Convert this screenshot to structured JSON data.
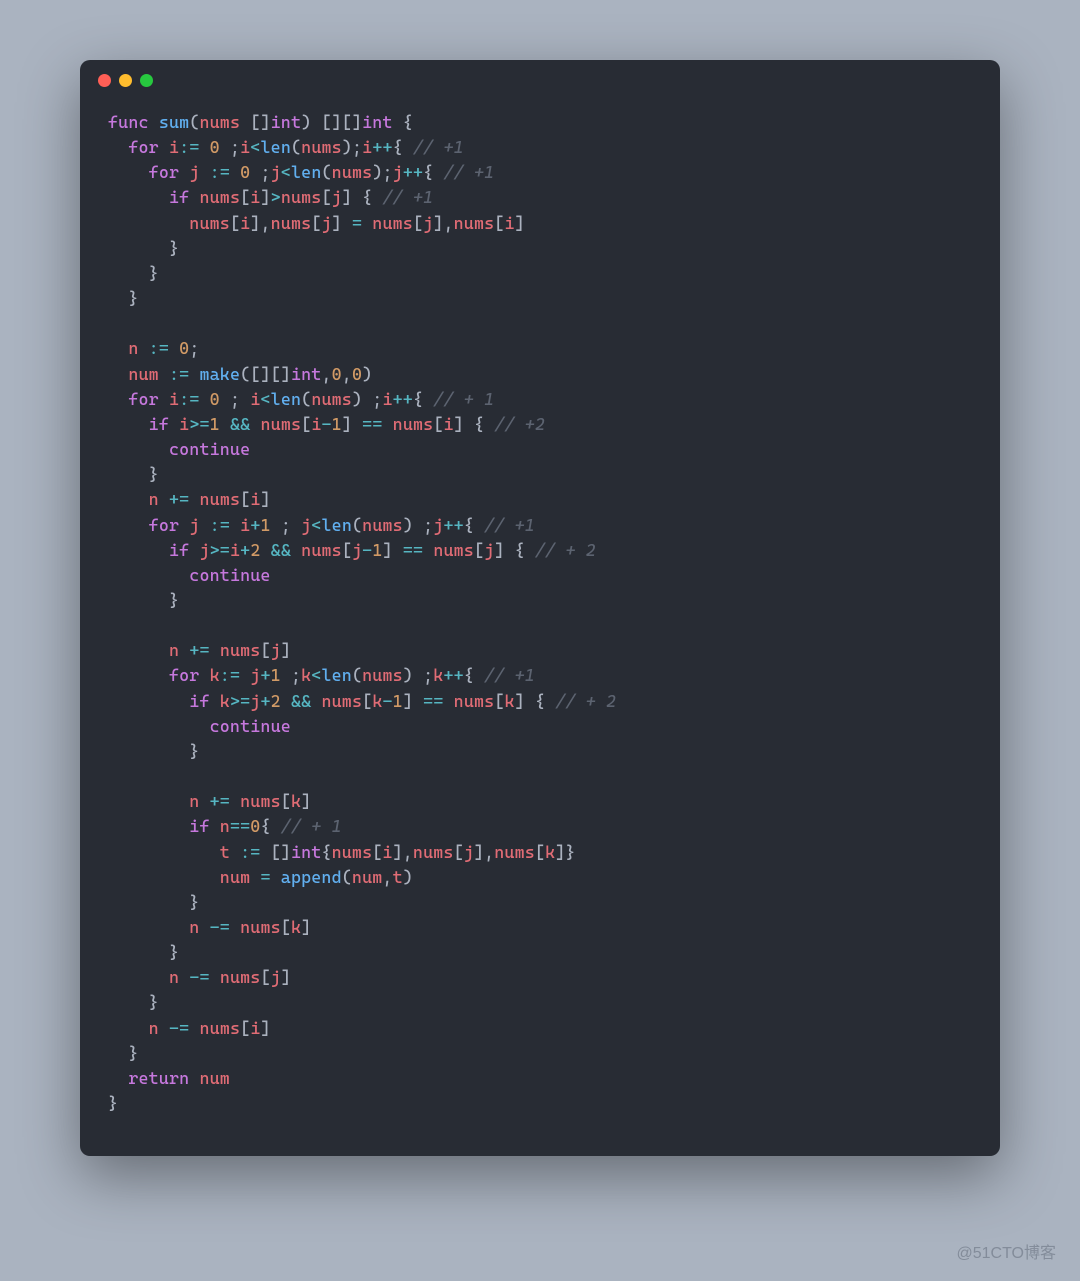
{
  "watermark": "@51CTO博客",
  "code_lines": [
    [
      [
        "kw",
        "func"
      ],
      [
        "pn",
        " "
      ],
      [
        "fn",
        "sum"
      ],
      [
        "pn",
        "("
      ],
      [
        "var",
        "nums"
      ],
      [
        "pn",
        " []"
      ],
      [
        "ty",
        "int"
      ],
      [
        "pn",
        ") [][]"
      ],
      [
        "ty",
        "int"
      ],
      [
        "pn",
        " {"
      ]
    ],
    [
      [
        "pn",
        "  "
      ],
      [
        "kw",
        "for"
      ],
      [
        "pn",
        " "
      ],
      [
        "var",
        "i"
      ],
      [
        "op",
        ":="
      ],
      [
        "pn",
        " "
      ],
      [
        "num",
        "0"
      ],
      [
        "pn",
        " ;"
      ],
      [
        "var",
        "i"
      ],
      [
        "op",
        "<"
      ],
      [
        "fn",
        "len"
      ],
      [
        "pn",
        "("
      ],
      [
        "var",
        "nums"
      ],
      [
        "pn",
        ");"
      ],
      [
        "var",
        "i"
      ],
      [
        "op",
        "++"
      ],
      [
        "pn",
        "{ "
      ],
      [
        "cm",
        "// +1"
      ]
    ],
    [
      [
        "pn",
        "    "
      ],
      [
        "kw",
        "for"
      ],
      [
        "pn",
        " "
      ],
      [
        "var",
        "j"
      ],
      [
        "pn",
        " "
      ],
      [
        "op",
        ":="
      ],
      [
        "pn",
        " "
      ],
      [
        "num",
        "0"
      ],
      [
        "pn",
        " ;"
      ],
      [
        "var",
        "j"
      ],
      [
        "op",
        "<"
      ],
      [
        "fn",
        "len"
      ],
      [
        "pn",
        "("
      ],
      [
        "var",
        "nums"
      ],
      [
        "pn",
        ");"
      ],
      [
        "var",
        "j"
      ],
      [
        "op",
        "++"
      ],
      [
        "pn",
        "{ "
      ],
      [
        "cm",
        "// +1"
      ]
    ],
    [
      [
        "pn",
        "      "
      ],
      [
        "kw",
        "if"
      ],
      [
        "pn",
        " "
      ],
      [
        "var",
        "nums"
      ],
      [
        "pn",
        "["
      ],
      [
        "var",
        "i"
      ],
      [
        "pn",
        "]"
      ],
      [
        "op",
        ">"
      ],
      [
        "var",
        "nums"
      ],
      [
        "pn",
        "["
      ],
      [
        "var",
        "j"
      ],
      [
        "pn",
        "] { "
      ],
      [
        "cm",
        "// +1"
      ]
    ],
    [
      [
        "pn",
        "        "
      ],
      [
        "var",
        "nums"
      ],
      [
        "pn",
        "["
      ],
      [
        "var",
        "i"
      ],
      [
        "pn",
        "],"
      ],
      [
        "var",
        "nums"
      ],
      [
        "pn",
        "["
      ],
      [
        "var",
        "j"
      ],
      [
        "pn",
        "] "
      ],
      [
        "op",
        "="
      ],
      [
        "pn",
        " "
      ],
      [
        "var",
        "nums"
      ],
      [
        "pn",
        "["
      ],
      [
        "var",
        "j"
      ],
      [
        "pn",
        "],"
      ],
      [
        "var",
        "nums"
      ],
      [
        "pn",
        "["
      ],
      [
        "var",
        "i"
      ],
      [
        "pn",
        "]"
      ]
    ],
    [
      [
        "pn",
        "      }"
      ]
    ],
    [
      [
        "pn",
        "    }"
      ]
    ],
    [
      [
        "pn",
        "  }"
      ]
    ],
    [
      [
        "pn",
        ""
      ]
    ],
    [
      [
        "pn",
        "  "
      ],
      [
        "var",
        "n"
      ],
      [
        "pn",
        " "
      ],
      [
        "op",
        ":="
      ],
      [
        "pn",
        " "
      ],
      [
        "num",
        "0"
      ],
      [
        "pn",
        ";"
      ]
    ],
    [
      [
        "pn",
        "  "
      ],
      [
        "var",
        "num"
      ],
      [
        "pn",
        " "
      ],
      [
        "op",
        ":="
      ],
      [
        "pn",
        " "
      ],
      [
        "fn",
        "make"
      ],
      [
        "pn",
        "([][]"
      ],
      [
        "ty",
        "int"
      ],
      [
        "pn",
        ","
      ],
      [
        "num",
        "0"
      ],
      [
        "pn",
        ","
      ],
      [
        "num",
        "0"
      ],
      [
        "pn",
        ")"
      ]
    ],
    [
      [
        "pn",
        "  "
      ],
      [
        "kw",
        "for"
      ],
      [
        "pn",
        " "
      ],
      [
        "var",
        "i"
      ],
      [
        "op",
        ":="
      ],
      [
        "pn",
        " "
      ],
      [
        "num",
        "0"
      ],
      [
        "pn",
        " ; "
      ],
      [
        "var",
        "i"
      ],
      [
        "op",
        "<"
      ],
      [
        "fn",
        "len"
      ],
      [
        "pn",
        "("
      ],
      [
        "var",
        "nums"
      ],
      [
        "pn",
        ") ;"
      ],
      [
        "var",
        "i"
      ],
      [
        "op",
        "++"
      ],
      [
        "pn",
        "{ "
      ],
      [
        "cm",
        "// + 1"
      ]
    ],
    [
      [
        "pn",
        "    "
      ],
      [
        "kw",
        "if"
      ],
      [
        "pn",
        " "
      ],
      [
        "var",
        "i"
      ],
      [
        "op",
        ">="
      ],
      [
        "num",
        "1"
      ],
      [
        "pn",
        " "
      ],
      [
        "op",
        "&&"
      ],
      [
        "pn",
        " "
      ],
      [
        "var",
        "nums"
      ],
      [
        "pn",
        "["
      ],
      [
        "var",
        "i"
      ],
      [
        "op",
        "-"
      ],
      [
        "num",
        "1"
      ],
      [
        "pn",
        "] "
      ],
      [
        "op",
        "=="
      ],
      [
        "pn",
        " "
      ],
      [
        "var",
        "nums"
      ],
      [
        "pn",
        "["
      ],
      [
        "var",
        "i"
      ],
      [
        "pn",
        "] { "
      ],
      [
        "cm",
        "// +2"
      ]
    ],
    [
      [
        "pn",
        "      "
      ],
      [
        "kw",
        "continue"
      ]
    ],
    [
      [
        "pn",
        "    }"
      ]
    ],
    [
      [
        "pn",
        "    "
      ],
      [
        "var",
        "n"
      ],
      [
        "pn",
        " "
      ],
      [
        "op",
        "+="
      ],
      [
        "pn",
        " "
      ],
      [
        "var",
        "nums"
      ],
      [
        "pn",
        "["
      ],
      [
        "var",
        "i"
      ],
      [
        "pn",
        "]"
      ]
    ],
    [
      [
        "pn",
        "    "
      ],
      [
        "kw",
        "for"
      ],
      [
        "pn",
        " "
      ],
      [
        "var",
        "j"
      ],
      [
        "pn",
        " "
      ],
      [
        "op",
        ":="
      ],
      [
        "pn",
        " "
      ],
      [
        "var",
        "i"
      ],
      [
        "op",
        "+"
      ],
      [
        "num",
        "1"
      ],
      [
        "pn",
        " ; "
      ],
      [
        "var",
        "j"
      ],
      [
        "op",
        "<"
      ],
      [
        "fn",
        "len"
      ],
      [
        "pn",
        "("
      ],
      [
        "var",
        "nums"
      ],
      [
        "pn",
        ") ;"
      ],
      [
        "var",
        "j"
      ],
      [
        "op",
        "++"
      ],
      [
        "pn",
        "{ "
      ],
      [
        "cm",
        "// +1"
      ]
    ],
    [
      [
        "pn",
        "      "
      ],
      [
        "kw",
        "if"
      ],
      [
        "pn",
        " "
      ],
      [
        "var",
        "j"
      ],
      [
        "op",
        ">="
      ],
      [
        "var",
        "i"
      ],
      [
        "op",
        "+"
      ],
      [
        "num",
        "2"
      ],
      [
        "pn",
        " "
      ],
      [
        "op",
        "&&"
      ],
      [
        "pn",
        " "
      ],
      [
        "var",
        "nums"
      ],
      [
        "pn",
        "["
      ],
      [
        "var",
        "j"
      ],
      [
        "op",
        "-"
      ],
      [
        "num",
        "1"
      ],
      [
        "pn",
        "] "
      ],
      [
        "op",
        "=="
      ],
      [
        "pn",
        " "
      ],
      [
        "var",
        "nums"
      ],
      [
        "pn",
        "["
      ],
      [
        "var",
        "j"
      ],
      [
        "pn",
        "] { "
      ],
      [
        "cm",
        "// + 2"
      ]
    ],
    [
      [
        "pn",
        "        "
      ],
      [
        "kw",
        "continue"
      ]
    ],
    [
      [
        "pn",
        "      }"
      ]
    ],
    [
      [
        "pn",
        ""
      ]
    ],
    [
      [
        "pn",
        "      "
      ],
      [
        "var",
        "n"
      ],
      [
        "pn",
        " "
      ],
      [
        "op",
        "+="
      ],
      [
        "pn",
        " "
      ],
      [
        "var",
        "nums"
      ],
      [
        "pn",
        "["
      ],
      [
        "var",
        "j"
      ],
      [
        "pn",
        "]"
      ]
    ],
    [
      [
        "pn",
        "      "
      ],
      [
        "kw",
        "for"
      ],
      [
        "pn",
        " "
      ],
      [
        "var",
        "k"
      ],
      [
        "op",
        ":="
      ],
      [
        "pn",
        " "
      ],
      [
        "var",
        "j"
      ],
      [
        "op",
        "+"
      ],
      [
        "num",
        "1"
      ],
      [
        "pn",
        " ;"
      ],
      [
        "var",
        "k"
      ],
      [
        "op",
        "<"
      ],
      [
        "fn",
        "len"
      ],
      [
        "pn",
        "("
      ],
      [
        "var",
        "nums"
      ],
      [
        "pn",
        ") ;"
      ],
      [
        "var",
        "k"
      ],
      [
        "op",
        "++"
      ],
      [
        "pn",
        "{ "
      ],
      [
        "cm",
        "// +1"
      ]
    ],
    [
      [
        "pn",
        "        "
      ],
      [
        "kw",
        "if"
      ],
      [
        "pn",
        " "
      ],
      [
        "var",
        "k"
      ],
      [
        "op",
        ">="
      ],
      [
        "var",
        "j"
      ],
      [
        "op",
        "+"
      ],
      [
        "num",
        "2"
      ],
      [
        "pn",
        " "
      ],
      [
        "op",
        "&&"
      ],
      [
        "pn",
        " "
      ],
      [
        "var",
        "nums"
      ],
      [
        "pn",
        "["
      ],
      [
        "var",
        "k"
      ],
      [
        "op",
        "-"
      ],
      [
        "num",
        "1"
      ],
      [
        "pn",
        "] "
      ],
      [
        "op",
        "=="
      ],
      [
        "pn",
        " "
      ],
      [
        "var",
        "nums"
      ],
      [
        "pn",
        "["
      ],
      [
        "var",
        "k"
      ],
      [
        "pn",
        "] { "
      ],
      [
        "cm",
        "// + 2"
      ]
    ],
    [
      [
        "pn",
        "          "
      ],
      [
        "kw",
        "continue"
      ]
    ],
    [
      [
        "pn",
        "        }"
      ]
    ],
    [
      [
        "pn",
        ""
      ]
    ],
    [
      [
        "pn",
        "        "
      ],
      [
        "var",
        "n"
      ],
      [
        "pn",
        " "
      ],
      [
        "op",
        "+="
      ],
      [
        "pn",
        " "
      ],
      [
        "var",
        "nums"
      ],
      [
        "pn",
        "["
      ],
      [
        "var",
        "k"
      ],
      [
        "pn",
        "]"
      ]
    ],
    [
      [
        "pn",
        "        "
      ],
      [
        "kw",
        "if"
      ],
      [
        "pn",
        " "
      ],
      [
        "var",
        "n"
      ],
      [
        "op",
        "=="
      ],
      [
        "num",
        "0"
      ],
      [
        "pn",
        "{ "
      ],
      [
        "cm",
        "// + 1"
      ]
    ],
    [
      [
        "pn",
        "           "
      ],
      [
        "var",
        "t"
      ],
      [
        "pn",
        " "
      ],
      [
        "op",
        ":="
      ],
      [
        "pn",
        " []"
      ],
      [
        "ty",
        "int"
      ],
      [
        "pn",
        "{"
      ],
      [
        "var",
        "nums"
      ],
      [
        "pn",
        "["
      ],
      [
        "var",
        "i"
      ],
      [
        "pn",
        "],"
      ],
      [
        "var",
        "nums"
      ],
      [
        "pn",
        "["
      ],
      [
        "var",
        "j"
      ],
      [
        "pn",
        "],"
      ],
      [
        "var",
        "nums"
      ],
      [
        "pn",
        "["
      ],
      [
        "var",
        "k"
      ],
      [
        "pn",
        "]}"
      ]
    ],
    [
      [
        "pn",
        "           "
      ],
      [
        "var",
        "num"
      ],
      [
        "pn",
        " "
      ],
      [
        "op",
        "="
      ],
      [
        "pn",
        " "
      ],
      [
        "fn",
        "append"
      ],
      [
        "pn",
        "("
      ],
      [
        "var",
        "num"
      ],
      [
        "pn",
        ","
      ],
      [
        "var",
        "t"
      ],
      [
        "pn",
        ")"
      ]
    ],
    [
      [
        "pn",
        "        }"
      ]
    ],
    [
      [
        "pn",
        "        "
      ],
      [
        "var",
        "n"
      ],
      [
        "pn",
        " "
      ],
      [
        "op",
        "-="
      ],
      [
        "pn",
        " "
      ],
      [
        "var",
        "nums"
      ],
      [
        "pn",
        "["
      ],
      [
        "var",
        "k"
      ],
      [
        "pn",
        "]"
      ]
    ],
    [
      [
        "pn",
        "      }"
      ]
    ],
    [
      [
        "pn",
        "      "
      ],
      [
        "var",
        "n"
      ],
      [
        "pn",
        " "
      ],
      [
        "op",
        "-="
      ],
      [
        "pn",
        " "
      ],
      [
        "var",
        "nums"
      ],
      [
        "pn",
        "["
      ],
      [
        "var",
        "j"
      ],
      [
        "pn",
        "]"
      ]
    ],
    [
      [
        "pn",
        "    }"
      ]
    ],
    [
      [
        "pn",
        "    "
      ],
      [
        "var",
        "n"
      ],
      [
        "pn",
        " "
      ],
      [
        "op",
        "-="
      ],
      [
        "pn",
        " "
      ],
      [
        "var",
        "nums"
      ],
      [
        "pn",
        "["
      ],
      [
        "var",
        "i"
      ],
      [
        "pn",
        "]"
      ]
    ],
    [
      [
        "pn",
        "  }"
      ]
    ],
    [
      [
        "pn",
        "  "
      ],
      [
        "kw",
        "return"
      ],
      [
        "pn",
        " "
      ],
      [
        "var",
        "num"
      ]
    ],
    [
      [
        "pn",
        "}"
      ]
    ]
  ]
}
